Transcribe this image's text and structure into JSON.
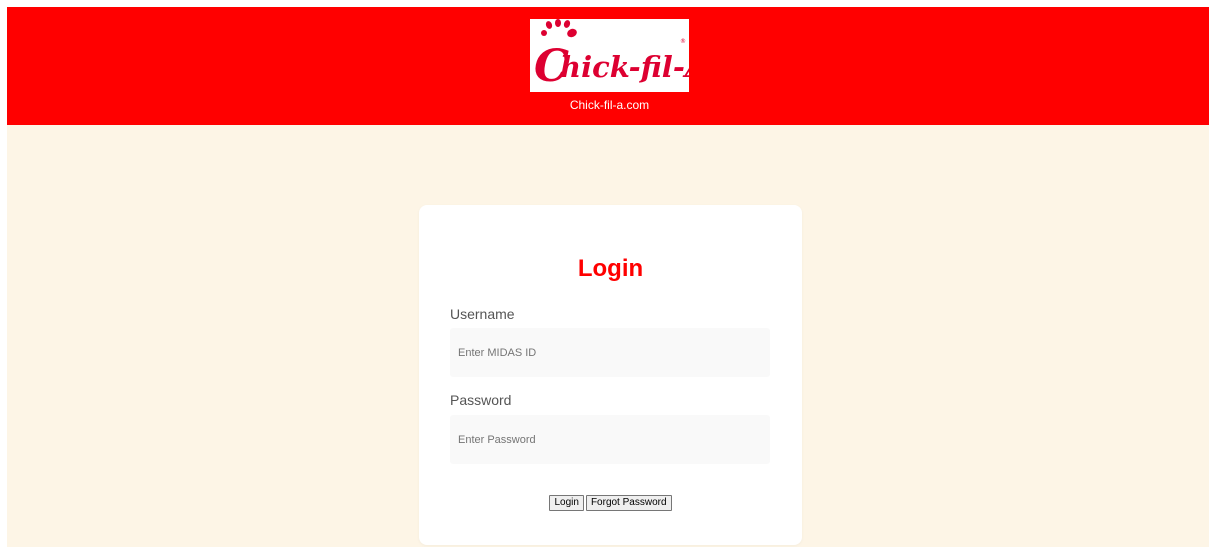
{
  "header": {
    "logo_text": "Chick-fil-A",
    "logo_caption": "Chick-fil-a.com",
    "background_color": "#ff0000"
  },
  "login": {
    "title": "Login",
    "title_color": "#ff0000",
    "username_label": "Username",
    "username_placeholder": "Enter MIDAS ID",
    "username_value": "",
    "password_label": "Password",
    "password_placeholder": "Enter Password",
    "password_value": "",
    "login_button": "Login",
    "forgot_button": "Forgot Password"
  },
  "page_background": "#fdf5e6"
}
